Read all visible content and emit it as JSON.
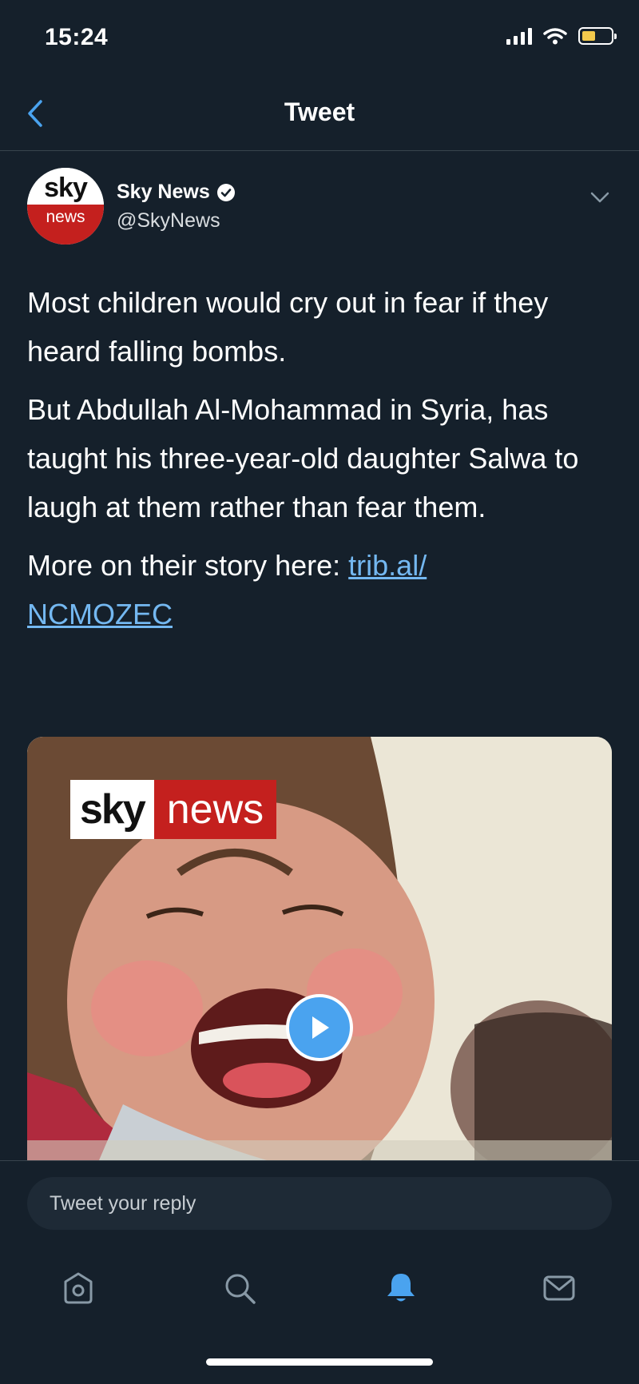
{
  "status_bar": {
    "time": "15:24"
  },
  "nav": {
    "title": "Tweet"
  },
  "tweet": {
    "author": {
      "name": "Sky News",
      "handle": "@SkyNews",
      "avatar_top": "sky",
      "avatar_bottom": "news"
    },
    "paragraphs": [
      "Most children would cry out in fear if they heard falling bombs.",
      "But Abdullah Al-Mohammad in Syria, has taught his three-year-old daughter Salwa to laugh at them rather than fear them."
    ],
    "link_intro": "More on their story here: ",
    "link_text": "trib.al/ NCMOZEC",
    "media": {
      "logo_sky": "sky",
      "logo_news": "news"
    }
  },
  "reply": {
    "placeholder": "Tweet your reply"
  },
  "tabs": [
    {
      "icon": "home-icon"
    },
    {
      "icon": "search-icon"
    },
    {
      "icon": "notifications-icon"
    },
    {
      "icon": "messages-icon"
    }
  ],
  "colors": {
    "background": "#15202b",
    "link": "#74b8f1",
    "accent": "#4aa3ef",
    "divider": "#38444d"
  }
}
